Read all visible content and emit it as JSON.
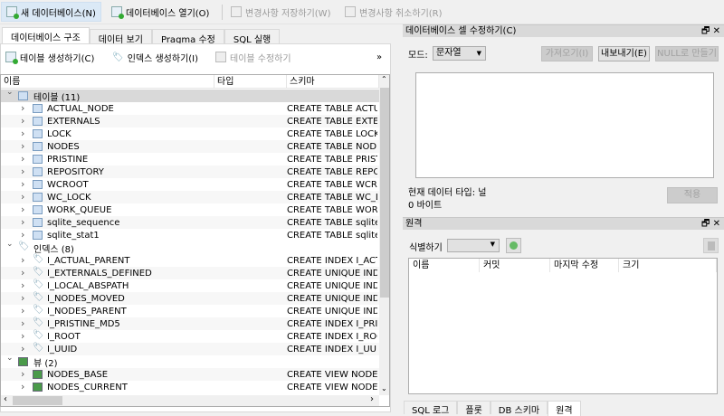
{
  "toolbar": {
    "new_db": "새 데이터베이스(N)",
    "open_db": "데이터베이스 열기(O)",
    "write_changes": "변경사항 저장하기(W)",
    "revert_changes": "변경사항 취소하기(R)"
  },
  "tabs": [
    "데이터베이스 구조",
    "데이터 보기",
    "Pragma 수정",
    "SQL 실행"
  ],
  "structure_toolbar": {
    "create_table": "테이블 생성하기(C)",
    "create_index": "인덱스 생성하기(I)",
    "modify_table": "테이블 수정하기",
    "more": "»"
  },
  "tree": {
    "columns": [
      "이름",
      "타입",
      "스키마"
    ],
    "groups": [
      {
        "label": "테이블 (11)",
        "kind": "table",
        "items": [
          {
            "name": "ACTUAL_NODE",
            "schema": "CREATE TABLE ACTUAL_"
          },
          {
            "name": "EXTERNALS",
            "schema": "CREATE TABLE EXTERNA"
          },
          {
            "name": "LOCK",
            "schema": "CREATE TABLE LOCK ( r"
          },
          {
            "name": "NODES",
            "schema": "CREATE TABLE NODES ("
          },
          {
            "name": "PRISTINE",
            "schema": "CREATE TABLE PRISTINE"
          },
          {
            "name": "REPOSITORY",
            "schema": "CREATE TABLE REPOSITO"
          },
          {
            "name": "WCROOT",
            "schema": "CREATE TABLE WCROOT"
          },
          {
            "name": "WC_LOCK",
            "schema": "CREATE TABLE WC_LOC"
          },
          {
            "name": "WORK_QUEUE",
            "schema": "CREATE TABLE WORK_Q"
          },
          {
            "name": "sqlite_sequence",
            "schema": "CREATE TABLE sqlite_sec"
          },
          {
            "name": "sqlite_stat1",
            "schema": "CREATE TABLE sqlite_sta"
          }
        ]
      },
      {
        "label": "인덱스 (8)",
        "kind": "idx",
        "items": [
          {
            "name": "I_ACTUAL_PARENT",
            "schema": "CREATE INDEX I_ACTUA"
          },
          {
            "name": "I_EXTERNALS_DEFINED",
            "schema": "CREATE UNIQUE INDEX"
          },
          {
            "name": "I_LOCAL_ABSPATH",
            "schema": "CREATE UNIQUE INDEX"
          },
          {
            "name": "I_NODES_MOVED",
            "schema": "CREATE UNIQUE INDEX"
          },
          {
            "name": "I_NODES_PARENT",
            "schema": "CREATE UNIQUE INDEX"
          },
          {
            "name": "I_PRISTINE_MD5",
            "schema": "CREATE INDEX I_PRISTIN"
          },
          {
            "name": "I_ROOT",
            "schema": "CREATE INDEX I_ROOT C"
          },
          {
            "name": "I_UUID",
            "schema": "CREATE INDEX I_UUID C"
          }
        ]
      },
      {
        "label": "뷰 (2)",
        "kind": "view",
        "items": [
          {
            "name": "NODES_BASE",
            "schema": "CREATE VIEW NODES_B"
          },
          {
            "name": "NODES_CURRENT",
            "schema": "CREATE VIEW NODES_C"
          }
        ]
      }
    ]
  },
  "edit_cell": {
    "title": "데이터베이스 셀 수정하기(C)",
    "mode_label": "모드:",
    "mode_value": "문자열",
    "import": "가져오기(I)",
    "export": "내보내기(E)",
    "set_null": "NULL로 만들기",
    "data_type": "현재 데이터 타입: 널",
    "size": "0 바이트",
    "apply": "적용"
  },
  "remote": {
    "title": "원격",
    "identity_label": "식별하기",
    "columns": [
      "이름",
      "커밋",
      "마지막 수정",
      "크기"
    ]
  },
  "dock_controls": {
    "float": "🗗",
    "close": "✕"
  },
  "bottom_tabs": [
    "SQL 로그",
    "플롯",
    "DB 스키마",
    "원격"
  ]
}
